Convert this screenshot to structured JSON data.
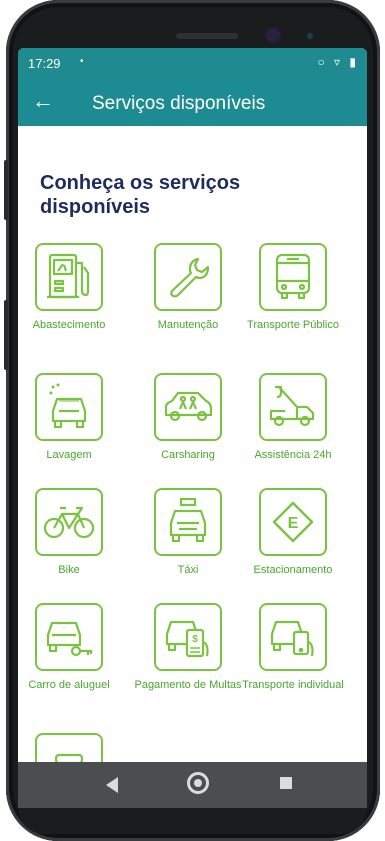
{
  "status_bar": {
    "time": "17:29",
    "notification_dot": "•",
    "icons": "○ ▿ ▮"
  },
  "app_bar": {
    "back_glyph": "←",
    "title": "Serviços disponíveis"
  },
  "heading": "Conheça os serviços disponíveis",
  "colors": {
    "teal": "#1c8c92",
    "green": "#7cc242",
    "label_green": "#4aa62d",
    "heading_navy": "#1f2d5e"
  },
  "services": [
    {
      "label": "Abastecimento",
      "icon": "fuel-pump-icon"
    },
    {
      "label": "Manutenção",
      "icon": "wrench-icon"
    },
    {
      "label": "Transporte Público",
      "icon": "bus-icon"
    },
    {
      "label": "Lavagem",
      "icon": "car-wash-icon"
    },
    {
      "label": "Carsharing",
      "icon": "carsharing-icon"
    },
    {
      "label": "Assistência 24h",
      "icon": "tow-truck-icon"
    },
    {
      "label": "Bike",
      "icon": "bicycle-icon"
    },
    {
      "label": "Táxi",
      "icon": "taxi-icon"
    },
    {
      "label": "Estacionamento",
      "icon": "parking-sign-icon"
    },
    {
      "label": "Carro de aluguel",
      "icon": "car-rental-key-icon"
    },
    {
      "label": "Pagamento de Multas",
      "icon": "fine-payment-icon"
    },
    {
      "label": "Transporte individual",
      "icon": "ride-hailing-phone-icon"
    },
    {
      "label": "",
      "icon": "car-partial-icon"
    }
  ],
  "nav_bar": {
    "back": "back-nav-icon",
    "home": "home-nav-icon",
    "recent": "recent-apps-icon"
  }
}
